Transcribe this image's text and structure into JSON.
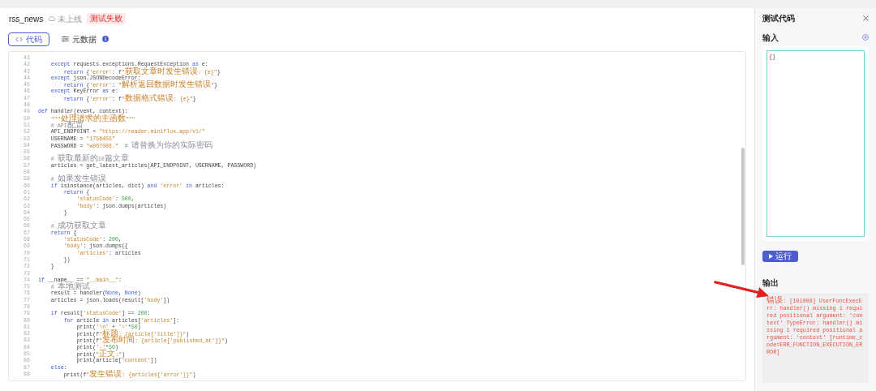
{
  "header": {
    "title": "rss_news",
    "status": "未上线",
    "badge": "测试失败"
  },
  "tabs": [
    {
      "label": "代码",
      "selected": true,
      "kind": "code"
    },
    {
      "label": "元数据",
      "selected": false,
      "kind": "meta"
    }
  ],
  "code": [
    {
      "num": "41"
    },
    {
      "num": "42",
      "seg": [
        {
          "kind": "keyword",
          "text": "    except"
        },
        {
          "kind": "plain",
          "text": " requests.exceptions.RequestException "
        },
        {
          "kind": "keyword",
          "text": "as"
        },
        {
          "kind": "plain",
          "text": " e:"
        }
      ]
    },
    {
      "num": "43",
      "seg": [
        {
          "kind": "keyword",
          "text": "        return"
        },
        {
          "kind": "plain",
          "text": " {"
        },
        {
          "kind": "string",
          "text": "'error'"
        },
        {
          "kind": "plain",
          "text": ": f"
        },
        {
          "kind": "string",
          "text": "\"获取文章时发生错误: {e}\""
        },
        {
          "kind": "plain",
          "text": "}"
        }
      ]
    },
    {
      "num": "44",
      "seg": [
        {
          "kind": "keyword",
          "text": "    except"
        },
        {
          "kind": "plain",
          "text": " json.JSONDecodeError:"
        }
      ]
    },
    {
      "num": "45",
      "seg": [
        {
          "kind": "keyword",
          "text": "        return"
        },
        {
          "kind": "plain",
          "text": " {"
        },
        {
          "kind": "string",
          "text": "'error'"
        },
        {
          "kind": "plain",
          "text": ": "
        },
        {
          "kind": "string",
          "text": "\"解析返回数据时发生错误\""
        },
        {
          "kind": "plain",
          "text": "}"
        }
      ]
    },
    {
      "num": "46",
      "seg": [
        {
          "kind": "keyword",
          "text": "    except"
        },
        {
          "kind": "plain",
          "text": " KeyError "
        },
        {
          "kind": "keyword",
          "text": "as"
        },
        {
          "kind": "plain",
          "text": " e:"
        }
      ]
    },
    {
      "num": "47",
      "seg": [
        {
          "kind": "keyword",
          "text": "        return"
        },
        {
          "kind": "plain",
          "text": " {"
        },
        {
          "kind": "string",
          "text": "'error'"
        },
        {
          "kind": "plain",
          "text": ": f"
        },
        {
          "kind": "string",
          "text": "\"数据格式错误: {e}\""
        },
        {
          "kind": "plain",
          "text": "}"
        }
      ]
    },
    {
      "num": "48"
    },
    {
      "num": "49",
      "seg": [
        {
          "kind": "keyword",
          "text": "def"
        },
        {
          "kind": "plain",
          "text": " handler(event, context):"
        }
      ]
    },
    {
      "num": "50",
      "seg": [
        {
          "kind": "string",
          "text": "    \"\"\"处理请求的主函数\"\"\""
        }
      ]
    },
    {
      "num": "51",
      "seg": [
        {
          "kind": "comment",
          "text": "    # API配置"
        }
      ]
    },
    {
      "num": "52",
      "seg": [
        {
          "kind": "plain",
          "text": "    API_ENDPOINT = "
        },
        {
          "kind": "string",
          "text": "\"https://reader.miniflux.app/v1/\""
        }
      ]
    },
    {
      "num": "53",
      "seg": [
        {
          "kind": "plain",
          "text": "    USERNAME = "
        },
        {
          "kind": "string",
          "text": "\"1756455\""
        }
      ]
    },
    {
      "num": "54",
      "seg": [
        {
          "kind": "plain",
          "text": "    PASSWORD = "
        },
        {
          "kind": "string",
          "text": "\"w067086.\""
        },
        {
          "kind": "comment",
          "text": "  # 请替换为你的实际密码"
        }
      ]
    },
    {
      "num": "55"
    },
    {
      "num": "56",
      "seg": [
        {
          "kind": "comment",
          "text": "    # 获取最新的10篇文章"
        }
      ]
    },
    {
      "num": "57",
      "seg": [
        {
          "kind": "plain",
          "text": "    articles = get_latest_articles(API_ENDPOINT, USERNAME, PASSWORD)"
        }
      ]
    },
    {
      "num": "58"
    },
    {
      "num": "59",
      "seg": [
        {
          "kind": "comment",
          "text": "    # 如果发生错误"
        }
      ]
    },
    {
      "num": "60",
      "seg": [
        {
          "kind": "keyword",
          "text": "    if"
        },
        {
          "kind": "plain",
          "text": " isinstance(articles, dict) "
        },
        {
          "kind": "keyword",
          "text": "and"
        },
        {
          "kind": "string",
          "text": " 'error'"
        },
        {
          "kind": "keyword",
          "text": " in"
        },
        {
          "kind": "plain",
          "text": " articles:"
        }
      ]
    },
    {
      "num": "61",
      "seg": [
        {
          "kind": "keyword",
          "text": "        return"
        },
        {
          "kind": "plain",
          "text": " {"
        }
      ]
    },
    {
      "num": "62",
      "seg": [
        {
          "kind": "string",
          "text": "            'statusCode'"
        },
        {
          "kind": "plain",
          "text": ": "
        },
        {
          "kind": "number",
          "text": "500"
        },
        {
          "kind": "plain",
          "text": ","
        }
      ]
    },
    {
      "num": "63",
      "seg": [
        {
          "kind": "string",
          "text": "            'body'"
        },
        {
          "kind": "plain",
          "text": ": json.dumps(articles)"
        }
      ]
    },
    {
      "num": "64",
      "seg": [
        {
          "kind": "plain",
          "text": "        }"
        }
      ]
    },
    {
      "num": "65"
    },
    {
      "num": "66",
      "seg": [
        {
          "kind": "comment",
          "text": "    # 成功获取文章"
        }
      ]
    },
    {
      "num": "67",
      "seg": [
        {
          "kind": "keyword",
          "text": "    return"
        },
        {
          "kind": "plain",
          "text": " {"
        }
      ]
    },
    {
      "num": "68",
      "seg": [
        {
          "kind": "string",
          "text": "        'statusCode'"
        },
        {
          "kind": "plain",
          "text": ": "
        },
        {
          "kind": "number",
          "text": "200"
        },
        {
          "kind": "plain",
          "text": ","
        }
      ]
    },
    {
      "num": "69",
      "seg": [
        {
          "kind": "string",
          "text": "        'body'"
        },
        {
          "kind": "plain",
          "text": ": json.dumps({"
        }
      ]
    },
    {
      "num": "70",
      "seg": [
        {
          "kind": "string",
          "text": "            'articles'"
        },
        {
          "kind": "plain",
          "text": ": articles"
        }
      ]
    },
    {
      "num": "71",
      "seg": [
        {
          "kind": "plain",
          "text": "        })"
        }
      ]
    },
    {
      "num": "72",
      "seg": [
        {
          "kind": "plain",
          "text": "    }"
        }
      ]
    },
    {
      "num": "73"
    },
    {
      "num": "74",
      "seg": [
        {
          "kind": "keyword",
          "text": "if"
        },
        {
          "kind": "plain",
          "text": " __name__ == "
        },
        {
          "kind": "string",
          "text": "\"__main__\""
        },
        {
          "kind": "plain",
          "text": ":"
        }
      ]
    },
    {
      "num": "75",
      "seg": [
        {
          "kind": "comment",
          "text": "    # 本地测试"
        }
      ]
    },
    {
      "num": "76",
      "seg": [
        {
          "kind": "plain",
          "text": "    result = handler("
        },
        {
          "kind": "keyword",
          "text": "None"
        },
        {
          "kind": "plain",
          "text": ", "
        },
        {
          "kind": "keyword",
          "text": "None"
        },
        {
          "kind": "plain",
          "text": ")"
        }
      ]
    },
    {
      "num": "77",
      "seg": [
        {
          "kind": "plain",
          "text": "    articles = json.loads(result["
        },
        {
          "kind": "string",
          "text": "'body'"
        },
        {
          "kind": "plain",
          "text": "])"
        }
      ]
    },
    {
      "num": "78"
    },
    {
      "num": "79",
      "seg": [
        {
          "kind": "keyword",
          "text": "    if"
        },
        {
          "kind": "plain",
          "text": " result["
        },
        {
          "kind": "string",
          "text": "'statusCode'"
        },
        {
          "kind": "plain",
          "text": "] == "
        },
        {
          "kind": "number",
          "text": "200"
        },
        {
          "kind": "plain",
          "text": ":"
        }
      ]
    },
    {
      "num": "80",
      "seg": [
        {
          "kind": "keyword",
          "text": "        for"
        },
        {
          "kind": "plain",
          "text": " article "
        },
        {
          "kind": "keyword",
          "text": "in"
        },
        {
          "kind": "plain",
          "text": " articles["
        },
        {
          "kind": "string",
          "text": "'articles'"
        },
        {
          "kind": "plain",
          "text": "]:"
        }
      ]
    },
    {
      "num": "81",
      "seg": [
        {
          "kind": "plain",
          "text": "            print("
        },
        {
          "kind": "string",
          "text": "'\\n'"
        },
        {
          "kind": "plain",
          "text": " + "
        },
        {
          "kind": "string",
          "text": "'='"
        },
        {
          "kind": "plain",
          "text": "*"
        },
        {
          "kind": "number",
          "text": "50"
        },
        {
          "kind": "plain",
          "text": ")"
        }
      ]
    },
    {
      "num": "82",
      "seg": [
        {
          "kind": "plain",
          "text": "            print(f"
        },
        {
          "kind": "string",
          "text": "\"标题: {article['title']}\""
        },
        {
          "kind": "plain",
          "text": ")"
        }
      ]
    },
    {
      "num": "83",
      "seg": [
        {
          "kind": "plain",
          "text": "            print(f"
        },
        {
          "kind": "string",
          "text": "\"发布时间: {article['published_at']}\""
        },
        {
          "kind": "plain",
          "text": ")"
        }
      ]
    },
    {
      "num": "84",
      "seg": [
        {
          "kind": "plain",
          "text": "            print("
        },
        {
          "kind": "string",
          "text": "'-'"
        },
        {
          "kind": "plain",
          "text": "*"
        },
        {
          "kind": "number",
          "text": "50"
        },
        {
          "kind": "plain",
          "text": ")"
        }
      ]
    },
    {
      "num": "85",
      "seg": [
        {
          "kind": "plain",
          "text": "            print("
        },
        {
          "kind": "string",
          "text": "\"正文:\""
        },
        {
          "kind": "plain",
          "text": ")"
        }
      ]
    },
    {
      "num": "86",
      "seg": [
        {
          "kind": "plain",
          "text": "            print(article["
        },
        {
          "kind": "string",
          "text": "'content'"
        },
        {
          "kind": "plain",
          "text": "])"
        }
      ]
    },
    {
      "num": "87",
      "seg": [
        {
          "kind": "keyword",
          "text": "    else"
        },
        {
          "kind": "plain",
          "text": ":"
        }
      ]
    },
    {
      "num": "88",
      "seg": [
        {
          "kind": "plain",
          "text": "        print(f"
        },
        {
          "kind": "string",
          "text": "\"发生错误: {articles['error']}\""
        },
        {
          "kind": "plain",
          "text": ")"
        }
      ]
    }
  ],
  "test_panel": {
    "title": "测试代码",
    "input_label": "输入",
    "input_value": "{}",
    "run_button": "运行",
    "output_label": "输出",
    "output_text": "错误: [101008] UserFuncExecErr: handler() missing 1 required positional argument: 'context' TypeError: handler() missing 1 required positional argument: 'context' [runtime_code=ERR_FUNCTION_EXECUTION_ERROR]"
  }
}
